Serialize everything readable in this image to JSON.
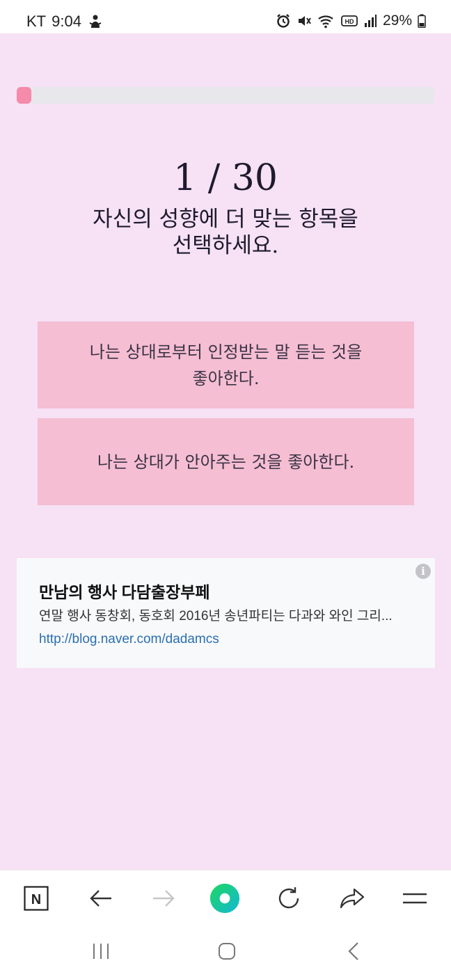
{
  "status_bar": {
    "carrier": "KT",
    "time": "9:04",
    "battery": "29%"
  },
  "progress": {
    "current": 1,
    "total": 30,
    "fraction": 0.0333,
    "accent": "#f58aab"
  },
  "question": {
    "counter": "1 / 30",
    "instruction_line1": "자신의 성향에 더 맞는 항목을",
    "instruction_line2": "선택하세요."
  },
  "choices": [
    {
      "line1": "나는 상대로부터 인정받는 말 듣는 것을",
      "line2": "좋아한다."
    },
    {
      "line1": "나는 상대가 안아주는 것을 좋아한다.",
      "line2": ""
    }
  ],
  "ad": {
    "title": "만남의 행사 다담출장부페",
    "description": "연말 행사 동창회, 동호회 2016년 송년파티는 다과와 와인 그리...",
    "url": "http://blog.naver.com/dadamcs",
    "info_symbol": "i"
  },
  "browser_toolbar": {
    "home_letter": "N",
    "icons": [
      "naver-home-icon",
      "back-arrow-icon",
      "forward-arrow-icon",
      "green-dot-icon",
      "reload-icon",
      "share-icon",
      "menu-icon"
    ]
  },
  "colors": {
    "background": "#f6e1f5",
    "choice_bg": "#f5bed3",
    "ad_bg": "#f8f9fb",
    "link": "#2a6fb0",
    "green_dot": "#19d08a"
  }
}
